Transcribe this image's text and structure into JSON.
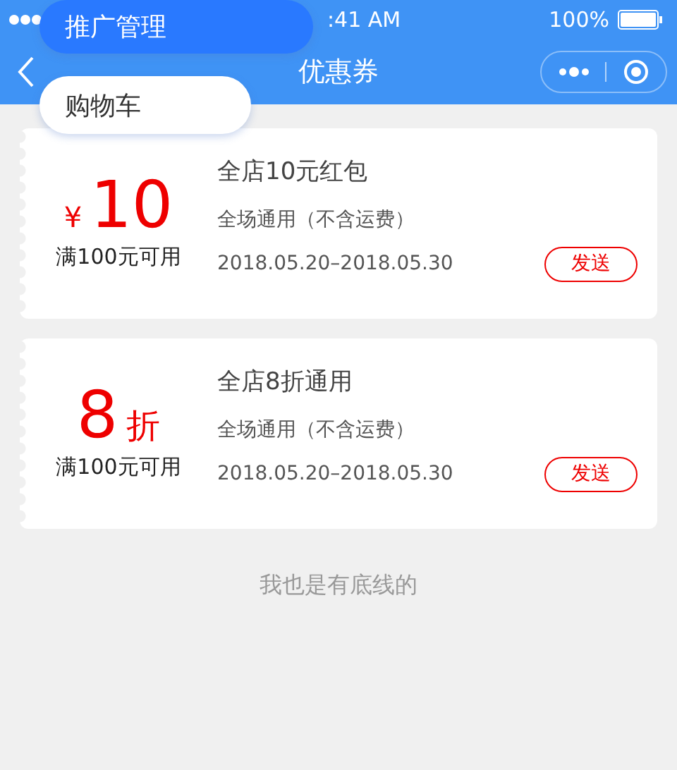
{
  "status_bar": {
    "time": ":41 AM",
    "battery": "100%"
  },
  "nav": {
    "title": "优惠券"
  },
  "popup_menu": [
    {
      "label": "推广管理",
      "selected": true
    },
    {
      "label": "购物车",
      "selected": false
    }
  ],
  "coupons": [
    {
      "kind": "cash",
      "currency": "¥",
      "amount": "10",
      "condition": "满100元可用",
      "title": "全店10元红包",
      "scope": "全场通用（不含运费）",
      "period": "2018.05.20–2018.05.30",
      "action": "发送"
    },
    {
      "kind": "discount",
      "amount": "8",
      "unit": "折",
      "condition": "满100元可用",
      "title": "全店8折通用",
      "scope": "全场通用（不含运费）",
      "period": "2018.05.20–2018.05.30",
      "action": "发送"
    }
  ],
  "footer": "我也是有底线的"
}
